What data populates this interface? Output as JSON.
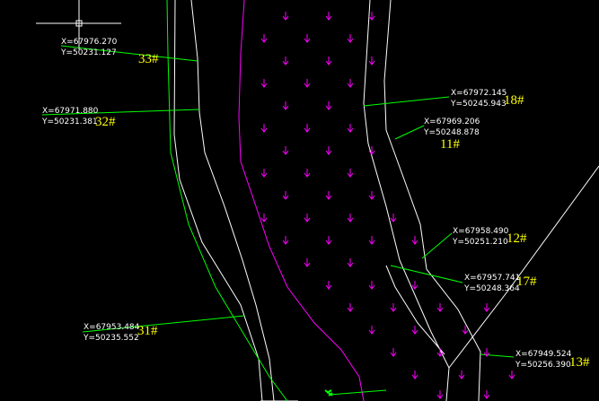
{
  "colors": {
    "background": "#000000",
    "line_white": "#ffffff",
    "line_green": "#00ff00",
    "line_magenta": "#ff00ff",
    "label_yellow": "#ffff00",
    "text_white": "#ffffff"
  },
  "survey_points": [
    {
      "id": "33#",
      "x": "X=67976.270",
      "y": "Y=50231.127"
    },
    {
      "id": "32#",
      "x": "X=67971.880",
      "y": "Y=50231.381"
    },
    {
      "id": "18#",
      "x": "X=67972.145",
      "y": "Y=50245.943"
    },
    {
      "id": "11#",
      "x": "X=67969.206",
      "y": "Y=50248.878"
    },
    {
      "id": "12#",
      "x": "X=67958.490",
      "y": "Y=50251.210"
    },
    {
      "id": "17#",
      "x": "X=67957.741",
      "y": "Y=50248.364"
    },
    {
      "id": "31#",
      "x": "X=67953.484",
      "y": "Y=50235.552"
    },
    {
      "id": "13#",
      "x": "X=67949.524",
      "y": "Y=50256.390"
    }
  ],
  "icons": {
    "cursor": "crosshair-cursor-icon",
    "vegetation": "vegetation-symbol-icon",
    "marker": "green-marker-icon"
  }
}
